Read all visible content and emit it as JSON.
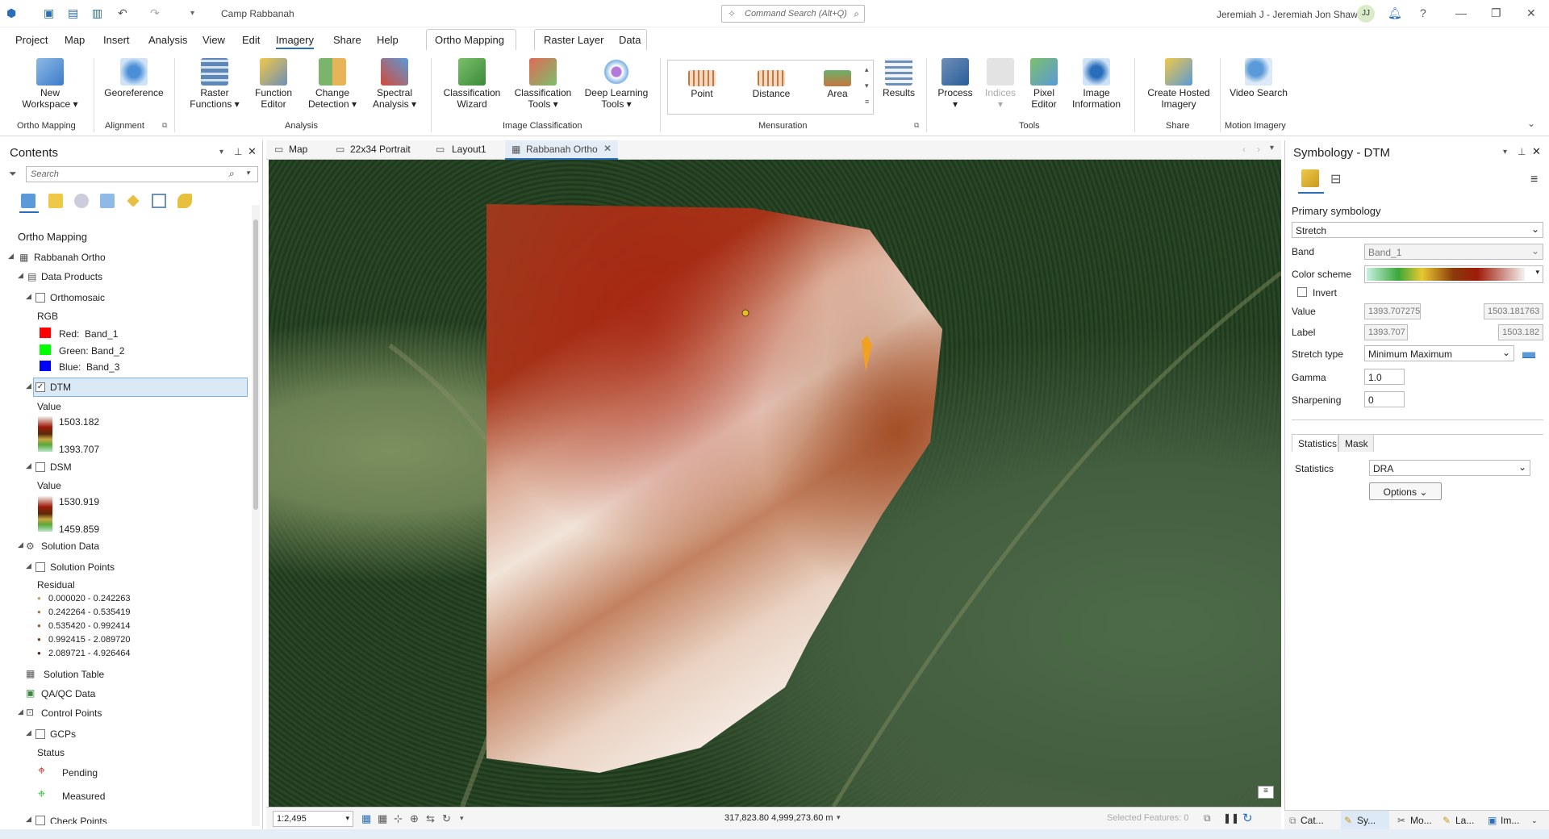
{
  "titlebar": {
    "project_name": "Camp Rabbanah",
    "command_search_placeholder": "Command Search (Alt+Q)",
    "user_name": "Jeremiah J - Jeremiah Jon Shaw",
    "avatar_initials": "JJ"
  },
  "menu": {
    "tabs": [
      "Project",
      "Map",
      "Insert",
      "Analysis",
      "View",
      "Edit",
      "Imagery",
      "Share",
      "Help"
    ],
    "active": "Imagery",
    "contextual_ortho": "Ortho Mapping",
    "contextual_raster": "Raster Layer",
    "contextual_data": "Data"
  },
  "ribbon": {
    "new_workspace": "New Workspace",
    "georeference": "Georeference",
    "raster_functions": "Raster Functions",
    "function_editor": "Function Editor",
    "change_detection": "Change Detection",
    "spectral_analysis": "Spectral Analysis",
    "classification_wizard": "Classification Wizard",
    "classification_tools": "Classification Tools",
    "deep_learning_tools": "Deep Learning Tools",
    "point": "Point",
    "distance": "Distance",
    "area": "Area",
    "results": "Results",
    "process": "Process",
    "indices": "Indices",
    "pixel_editor": "Pixel Editor",
    "image_information": "Image Information",
    "create_hosted_imagery": "Create Hosted Imagery",
    "video_search": "Video Search",
    "groups": {
      "ortho_mapping": "Ortho Mapping",
      "alignment": "Alignment",
      "analysis": "Analysis",
      "image_classification": "Image Classification",
      "mensuration": "Mensuration",
      "tools": "Tools",
      "share": "Share",
      "motion_imagery": "Motion Imagery"
    }
  },
  "contents": {
    "title": "Contents",
    "search_placeholder": "Search",
    "section": "Ortho Mapping",
    "workspace": "Rabbanah Ortho",
    "data_products": "Data Products",
    "orthomosaic": "Orthomosaic",
    "rgb": "RGB",
    "red": "Red:  Band_1",
    "green": "Green: Band_2",
    "blue": "Blue:  Band_3",
    "dtm": "DTM",
    "value_label": "Value",
    "dtm_max": "1503.182",
    "dtm_min": "1393.707",
    "dsm": "DSM",
    "dsm_max": "1530.919",
    "dsm_min": "1459.859",
    "solution_data": "Solution Data",
    "solution_points": "Solution Points",
    "residual": "Residual",
    "residual_classes": [
      "0.000020 - 0.242263",
      "0.242264 - 0.535419",
      "0.535420 - 0.992414",
      "0.992415 - 2.089720",
      "2.089721 - 4.926464"
    ],
    "solution_table": "Solution Table",
    "qa_qc_data": "QA/QC Data",
    "control_points": "Control Points",
    "gcps": "GCPs",
    "status": "Status",
    "pending": "Pending",
    "measured": "Measured",
    "check_points": "Check Points"
  },
  "view_tabs": [
    "Map",
    "22x34 Portrait",
    "Layout1",
    "Rabbanah Ortho"
  ],
  "status": {
    "scale": "1:2,495",
    "coordinates": "317,823.80 4,999,273.60 m",
    "selected_features": "Selected Features: 0"
  },
  "symbology": {
    "title": "Symbology - DTM",
    "primary": "Primary symbology",
    "renderer": "Stretch",
    "band_label": "Band",
    "band_value": "Band_1",
    "color_scheme_label": "Color scheme",
    "invert_label": "Invert",
    "value_label": "Value",
    "value_min": "1393.707275",
    "value_max": "1503.181763",
    "label_label": "Label",
    "label_min": "1393.707",
    "label_max": "1503.182",
    "stretch_type_label": "Stretch type",
    "stretch_type": "Minimum Maximum",
    "gamma_label": "Gamma",
    "gamma": "1.0",
    "sharpening_label": "Sharpening",
    "sharpening": "0",
    "tab_statistics": "Statistics",
    "tab_mask": "Mask",
    "statistics_label": "Statistics",
    "statistics_value": "DRA",
    "options": "Options"
  },
  "bottom_tabs": [
    "Cat...",
    "Sy...",
    "Mo...",
    "La...",
    "Im..."
  ],
  "colors": {
    "accent": "#2a6ebb",
    "dtm_high": "#9e1b0a",
    "dtm_low": "#f5f2ee",
    "forest": "#243f22"
  }
}
